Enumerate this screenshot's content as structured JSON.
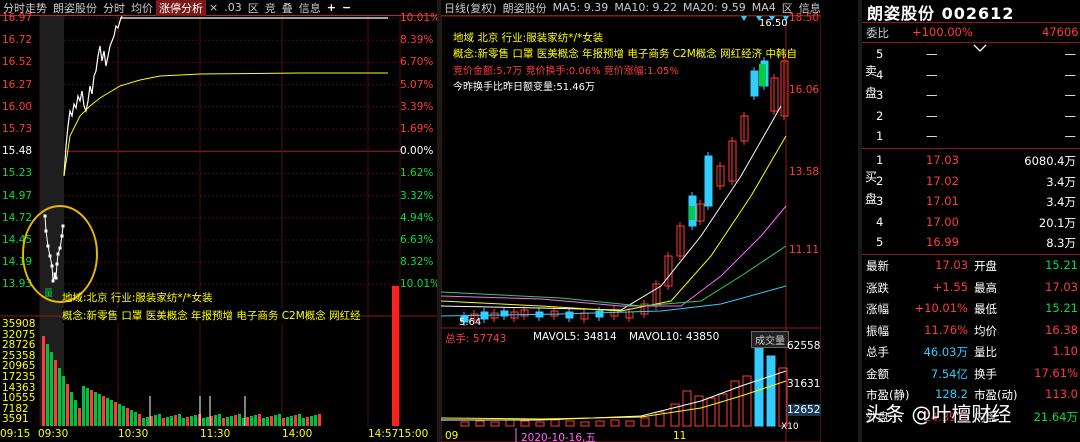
{
  "left_panel": {
    "tabs": [
      "分时走势",
      "朗姿股份",
      "分时",
      "均价",
      "涨停分析",
      "×",
      ".03",
      "区",
      "竞",
      "叠",
      "信息",
      "+",
      "−"
    ],
    "price_ticks": [
      "16.97",
      "16.72",
      "16.52",
      "16.27",
      "16.00",
      "15.73",
      "15.48",
      "15.23",
      "14.97",
      "14.72",
      "14.45",
      "14.19",
      "13.93"
    ],
    "pct_ticks": [
      "10.01%",
      "8.39%",
      "6.70%",
      "5.07%",
      "3.39%",
      "1.69%",
      "0.00%",
      "1.62%",
      "3.32%",
      "4.94%",
      "6.63%",
      "8.32%",
      "10.01%"
    ],
    "vol_ticks": [
      "35908",
      "32075",
      "28726",
      "25358",
      "20965",
      "17235",
      "14363",
      "10555",
      "7182",
      "3591"
    ],
    "time_ticks": [
      "09:15",
      "09:30",
      "10:30",
      "11:30",
      "14:00",
      "14:57",
      "15:00"
    ],
    "region_text": "地域:北京   行业:服装家纺*/*女装",
    "concept_text": "概念:新零售 口罩 医美概念 年报预增 电子商务 C2M概念 网红经",
    "volume_marker": "量"
  },
  "middle_panel": {
    "tabs": [
      "日线(复权)",
      "朗姿股份",
      "MA5: 9.39",
      "MA10: 9.22",
      "MA20: 9.59",
      "MA4",
      "区",
      "信息"
    ],
    "price_ticks": [
      "18.50",
      "16.06",
      "13.58",
      "11.11"
    ],
    "high_label": "16.50",
    "low_label": "5.64",
    "region_text": "地域   北京   行业:服装家纺*/*女装",
    "concept_text": "概念:新零售 口罩 医美概念 年报预增 电子商务 C2M概念 网红经济 中韩自",
    "auction_text": "竞价金额:5,7万 竞价换手:0.06% 竞价涨幅:1.05%",
    "turnover_text": "今昨换手比昨日额变量:51.46万",
    "vol_legend": [
      "总手: 57743",
      "MAVOL5: 34814",
      "MAVOL10: 43850"
    ],
    "vol_button": "成交量",
    "vol_ticks": [
      "62558",
      "31631",
      "12652"
    ],
    "vol_scale_label": "X10",
    "date_ticks": [
      "09",
      "2020-10-16,五",
      "11"
    ]
  },
  "quote_panel": {
    "title": "朗姿股份 002612",
    "weibi_label": "委比",
    "weibi_value": "+100.00%",
    "weicha_value": "47606",
    "sell_label": "卖盘",
    "buy_label": "买盘",
    "sell_rows": [
      {
        "level": "5",
        "price": "—",
        "vol": "—"
      },
      {
        "level": "4",
        "price": "—",
        "vol": "—"
      },
      {
        "level": "3",
        "price": "—",
        "vol": "—"
      },
      {
        "level": "2",
        "price": "—",
        "vol": "—"
      },
      {
        "level": "1",
        "price": "—",
        "vol": "—"
      }
    ],
    "buy_rows": [
      {
        "level": "1",
        "price": "17.03",
        "vol": "6080.4万"
      },
      {
        "level": "2",
        "price": "17.02",
        "vol": "3.4万"
      },
      {
        "level": "3",
        "price": "17.01",
        "vol": "3.4万"
      },
      {
        "level": "4",
        "price": "17.00",
        "vol": "20.1万"
      },
      {
        "level": "5",
        "price": "16.99",
        "vol": "8.3万"
      }
    ],
    "stats": [
      {
        "k1": "最新",
        "v1": "17.03",
        "k2": "开盘",
        "v2": "15.21"
      },
      {
        "k1": "涨跌",
        "v1": "+1.55",
        "k2": "最高",
        "v2": "17.03"
      },
      {
        "k1": "涨幅",
        "v1": "+10.01%",
        "k2": "最低",
        "v2": "15.21"
      },
      {
        "k1": "振幅",
        "v1": "11.76%",
        "k2": "均价",
        "v2": "16.38"
      },
      {
        "k1": "总手",
        "v1": "46.03万",
        "k2": "量比",
        "v2": "1.10"
      },
      {
        "k1": "金额",
        "v1": "7.54亿",
        "k2": "换手",
        "v2": "17.61%"
      },
      {
        "k1": "市盈(静)",
        "v1": "128.2",
        "k2": "市盈(动)",
        "v2": "113.0"
      },
      {
        "k1": "外盘",
        "v1": "24.39万",
        "k2": "内盘",
        "v2": "21.64万"
      }
    ]
  },
  "watermark": "头条 @叶檀财经",
  "colors": {
    "up": "#ff3b3b",
    "down": "#00e040",
    "bg": "#000000",
    "grid": "#8b1a1a",
    "label": "#ffff00",
    "cyan": "#33ccff"
  }
}
